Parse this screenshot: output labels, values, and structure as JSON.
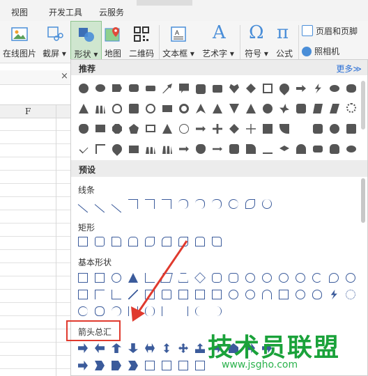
{
  "menubar": {
    "items": [
      "视图",
      "开发工具",
      "云服务"
    ]
  },
  "ribbon": {
    "online_image": "在线图片",
    "screenshot": "截屏 ▾",
    "shapes": "形状 ▾",
    "map": "地图",
    "qrcode": "二维码",
    "textbox": "文本框 ▾",
    "wordart": "艺术字 ▾",
    "wordart_glyph": "A",
    "symbol": "符号 ▾",
    "symbol_glyph": "Ω",
    "formula": "公式",
    "formula_glyph": "π",
    "header_footer": "页眉和页脚",
    "camera": "照相机"
  },
  "sheet": {
    "close": "×",
    "column": "F"
  },
  "panel": {
    "recommended": "推荐",
    "more": "更多≫",
    "preset": "预设",
    "cat_lines": "线条",
    "cat_rect": "矩形",
    "cat_basic": "基本形状",
    "cat_arrows": "箭头总汇"
  },
  "watermark": {
    "title": "技术员联盟",
    "url": "www.jsgho.com"
  },
  "colors": {
    "accent": "#2a6fd6",
    "shape_gray": "#555555",
    "outline": "#3b5b9b",
    "annotation_red": "#e03a2e",
    "watermark_green": "#1aa23a"
  }
}
